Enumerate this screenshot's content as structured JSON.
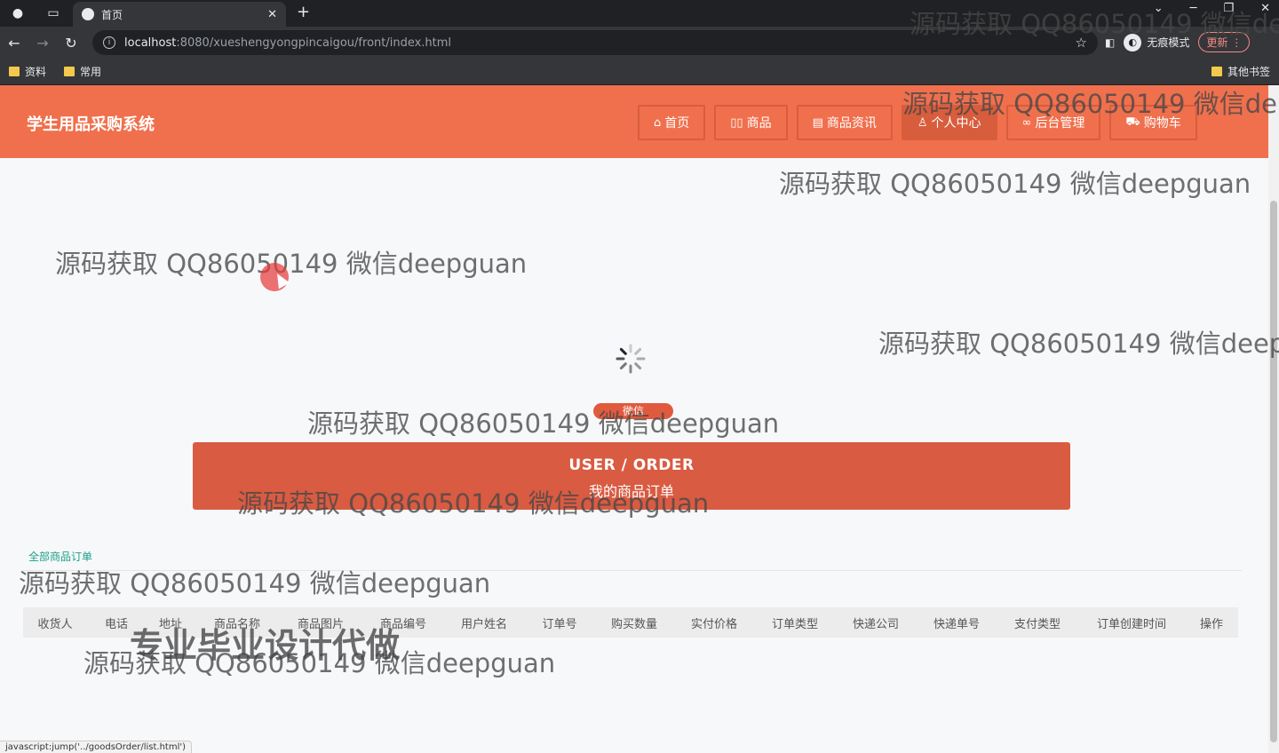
{
  "browser": {
    "tab_title": "首页",
    "url_host": "localhost",
    "url_path": ":8080/xueshengyongpincaigou/front/index.html",
    "incognito_label": "无痕模式",
    "update_label": "更新",
    "bookmarks": [
      "资料",
      "常用"
    ],
    "other_bookmarks": "其他书签"
  },
  "header": {
    "site_title": "学生用品采购系统",
    "nav": [
      {
        "label": "首页",
        "icon": "home-icon"
      },
      {
        "label": "商品",
        "icon": "grid-icon"
      },
      {
        "label": "商品资讯",
        "icon": "news-icon"
      },
      {
        "label": "个人中心",
        "icon": "user-icon",
        "active": true
      },
      {
        "label": "后台管理",
        "icon": "link-icon"
      },
      {
        "label": "购物车",
        "icon": "cart-icon"
      }
    ]
  },
  "loading": {
    "label": "微信"
  },
  "banner": {
    "title_en": "USER / ORDER",
    "title_cn": "我的商品订单"
  },
  "orders": {
    "tab_all": "全部商品订单",
    "columns": [
      "收货人",
      "电话",
      "地址",
      "商品名称",
      "商品图片",
      "商品编号",
      "用户姓名",
      "订单号",
      "购买数量",
      "实付价格",
      "订单类型",
      "快递公司",
      "快递单号",
      "支付类型",
      "订单创建时间",
      "操作"
    ]
  },
  "watermark": {
    "text_full": "源码获取 QQ86050149 微信deepguan",
    "text_cut_1": "源码获取 QQ86050149 微信de",
    "text_cut_2": "源码获取 QQ86050149 微信deep",
    "big_text": "专业毕业设计代做"
  },
  "status_bar": "javascript:jump('../goodsOrder/list.html')",
  "colors": {
    "header": "#f0704d",
    "banner": "#d95b42",
    "tab_active": "#1aa08a"
  }
}
